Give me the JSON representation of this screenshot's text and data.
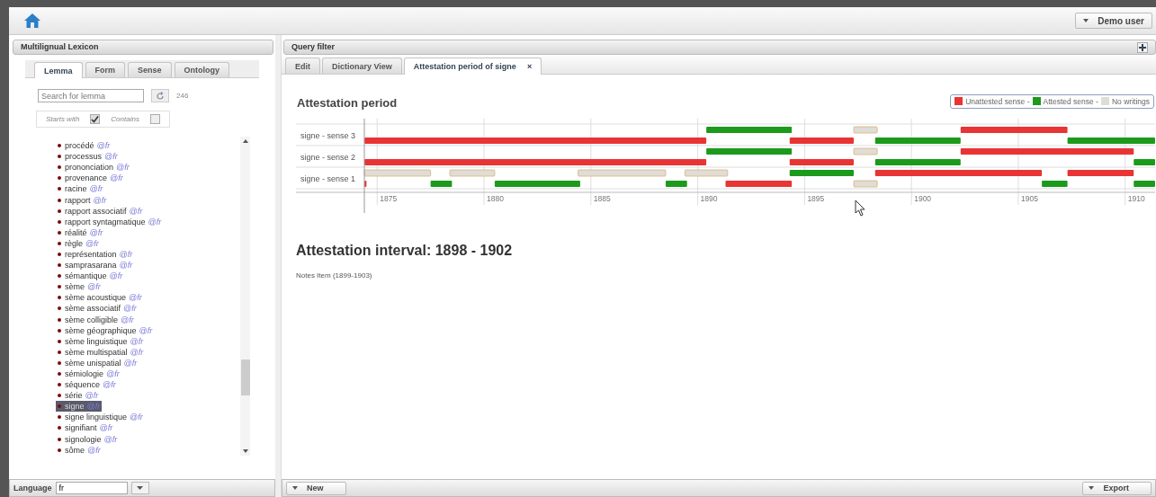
{
  "top_bar": {
    "user_menu": "Demo user"
  },
  "left_panel": {
    "title": "Multilignual Lexicon",
    "tabs": [
      {
        "label": "Lemma",
        "selected": true
      },
      {
        "label": "Form",
        "selected": false
      },
      {
        "label": "Sense",
        "selected": false
      },
      {
        "label": "Ontology",
        "selected": false
      }
    ],
    "search": {
      "placeholder": "Search for lemma",
      "count": "246"
    },
    "filters": [
      {
        "label": "Starts with",
        "checked": true
      },
      {
        "label": "Contains",
        "checked": false
      }
    ],
    "lemmas": [
      {
        "word": "procédé",
        "lang": "@fr",
        "selected": false
      },
      {
        "word": "processus",
        "lang": "@fr",
        "selected": false
      },
      {
        "word": "prononciation",
        "lang": "@fr",
        "selected": false
      },
      {
        "word": "provenance",
        "lang": "@fr",
        "selected": false
      },
      {
        "word": "racine",
        "lang": "@fr",
        "selected": false
      },
      {
        "word": "rapport",
        "lang": "@fr",
        "selected": false
      },
      {
        "word": "rapport associatif",
        "lang": "@fr",
        "selected": false
      },
      {
        "word": "rapport syntagmatique",
        "lang": "@fr",
        "selected": false
      },
      {
        "word": "réalité",
        "lang": "@fr",
        "selected": false
      },
      {
        "word": "règle",
        "lang": "@fr",
        "selected": false
      },
      {
        "word": "représentation",
        "lang": "@fr",
        "selected": false
      },
      {
        "word": "samprasarana",
        "lang": "@fr",
        "selected": false
      },
      {
        "word": "sémantique",
        "lang": "@fr",
        "selected": false
      },
      {
        "word": "sème",
        "lang": "@fr",
        "selected": false
      },
      {
        "word": "sème acoustique",
        "lang": "@fr",
        "selected": false
      },
      {
        "word": "sème associatif",
        "lang": "@fr",
        "selected": false
      },
      {
        "word": "sème colligible",
        "lang": "@fr",
        "selected": false
      },
      {
        "word": "sème géographique",
        "lang": "@fr",
        "selected": false
      },
      {
        "word": "sème linguistique",
        "lang": "@fr",
        "selected": false
      },
      {
        "word": "sème multispatial",
        "lang": "@fr",
        "selected": false
      },
      {
        "word": "sème unispatial",
        "lang": "@fr",
        "selected": false
      },
      {
        "word": "sémiologie",
        "lang": "@fr",
        "selected": false
      },
      {
        "word": "séquence",
        "lang": "@fr",
        "selected": false
      },
      {
        "word": "série",
        "lang": "@fr",
        "selected": false
      },
      {
        "word": "signe",
        "lang": "@fr",
        "selected": true
      },
      {
        "word": "signe linguistique",
        "lang": "@fr",
        "selected": false
      },
      {
        "word": "signifiant",
        "lang": "@fr",
        "selected": false
      },
      {
        "word": "signologie",
        "lang": "@fr",
        "selected": false
      },
      {
        "word": "sôme",
        "lang": "@fr",
        "selected": false
      }
    ],
    "language": {
      "label": "Language",
      "value": "fr"
    }
  },
  "right_panel": {
    "title": "Query filter",
    "tabs": [
      {
        "label": "Edit",
        "selected": false,
        "closable": false
      },
      {
        "label": "Dictionary View",
        "selected": false,
        "closable": false
      },
      {
        "label": "Attestation period of signe",
        "selected": true,
        "closable": true
      }
    ],
    "close_glyph": "×",
    "heading": "Attestation period",
    "legend": [
      {
        "label": "Unattested sense -",
        "color": "#e83434"
      },
      {
        "label": "Attested sense -",
        "color": "#1c9a1c"
      },
      {
        "label": "No writings",
        "color": "#e0dcd6"
      }
    ],
    "timeline": {
      "row_labels": [
        "signe - sense 3",
        "signe - sense 2",
        "signe - sense 1"
      ],
      "tick_labels": [
        "1875",
        "1880",
        "1885",
        "1890",
        "1895",
        "1900",
        "1905",
        "1910"
      ]
    },
    "interval": "Attestation interval: 1898 - 1902",
    "notes": "Notes Item (1899-1903)",
    "buttons": [
      {
        "label": "New"
      },
      {
        "label": "Export"
      }
    ]
  }
}
